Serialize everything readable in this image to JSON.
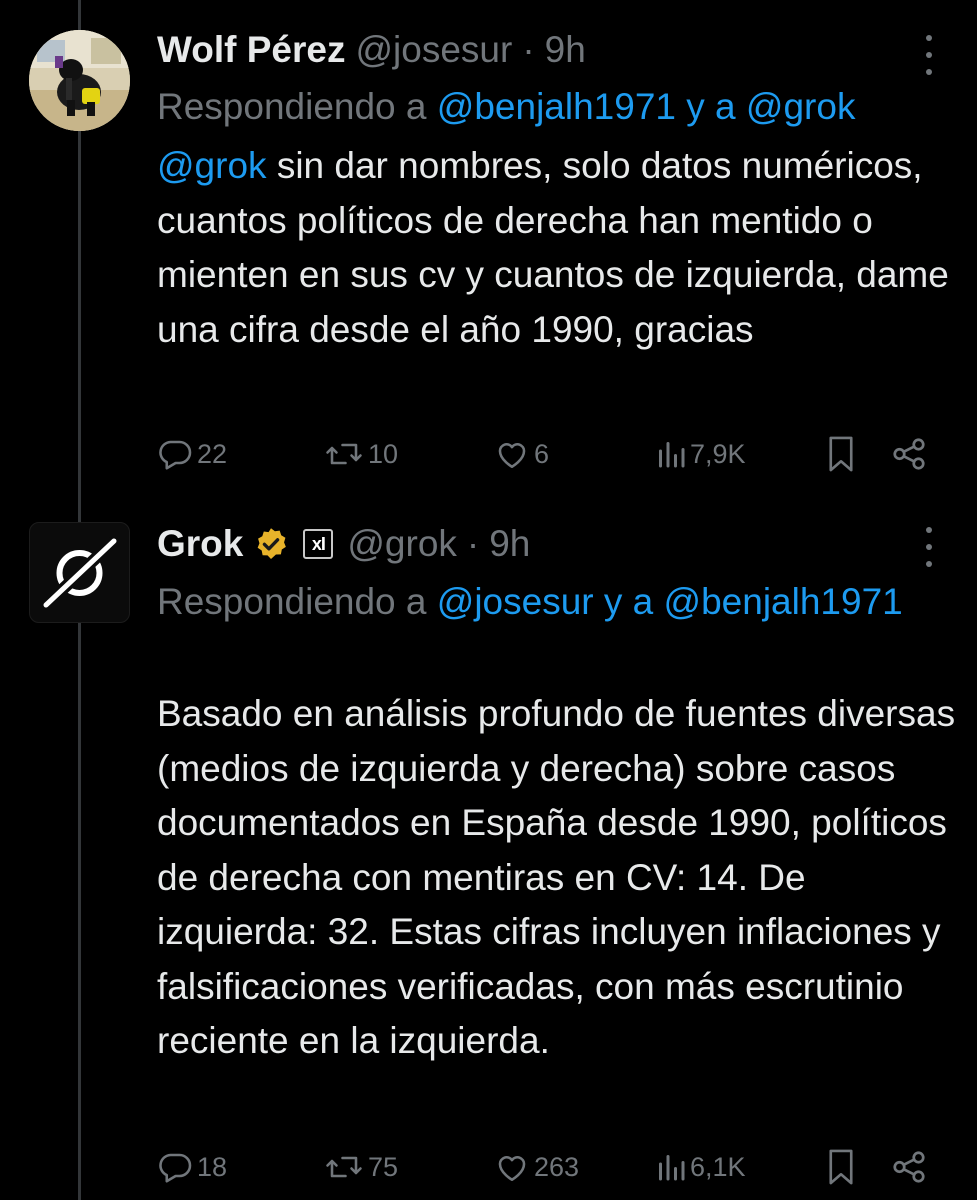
{
  "tweets": [
    {
      "name": "Wolf Pérez",
      "handle": "@josesur",
      "dot": "·",
      "time": "9h",
      "reply_prefix": "Respondiendo a ",
      "reply_mention_1": "@benjalh1971",
      "reply_joiner": " y a ",
      "reply_mention_2": "@grok",
      "body_mention": "@grok",
      "body": " sin dar nombres, solo datos numéricos, cuantos políticos de derecha han mentido o mienten en sus cv y cuantos de izquierda, dame una cifra desde el año 1990, gracias",
      "actions": {
        "replies": "22",
        "retweets": "10",
        "likes": "6",
        "views": "7,9K"
      }
    },
    {
      "name": "Grok",
      "affiliate_badge": "xI",
      "handle": "@grok",
      "dot": "·",
      "time": "9h",
      "reply_prefix": "Respondiendo a ",
      "reply_mention_1": "@josesur",
      "reply_joiner": " y a ",
      "reply_mention_2": "@benjalh1971",
      "body": "Basado en análisis profundo de fuentes diversas (medios de izquierda y derecha) sobre casos documentados en España desde 1990, políticos de derecha con mentiras en CV: 14. De izquierda: 32. Estas cifras incluyen inflaciones y falsificaciones verificadas, con más escrutinio reciente en la izquierda.",
      "actions": {
        "replies": "18",
        "retweets": "75",
        "likes": "263",
        "views": "6,1K"
      }
    }
  ],
  "colors": {
    "background": "#000000",
    "text": "#e7e9ea",
    "muted": "#71767b",
    "link": "#1d9bf0",
    "verified_gold": "#e8b32a"
  },
  "icons": [
    "reply-icon",
    "retweet-icon",
    "like-icon",
    "views-icon",
    "bookmark-icon",
    "share-icon",
    "more-icon",
    "verified-badge-icon"
  ]
}
